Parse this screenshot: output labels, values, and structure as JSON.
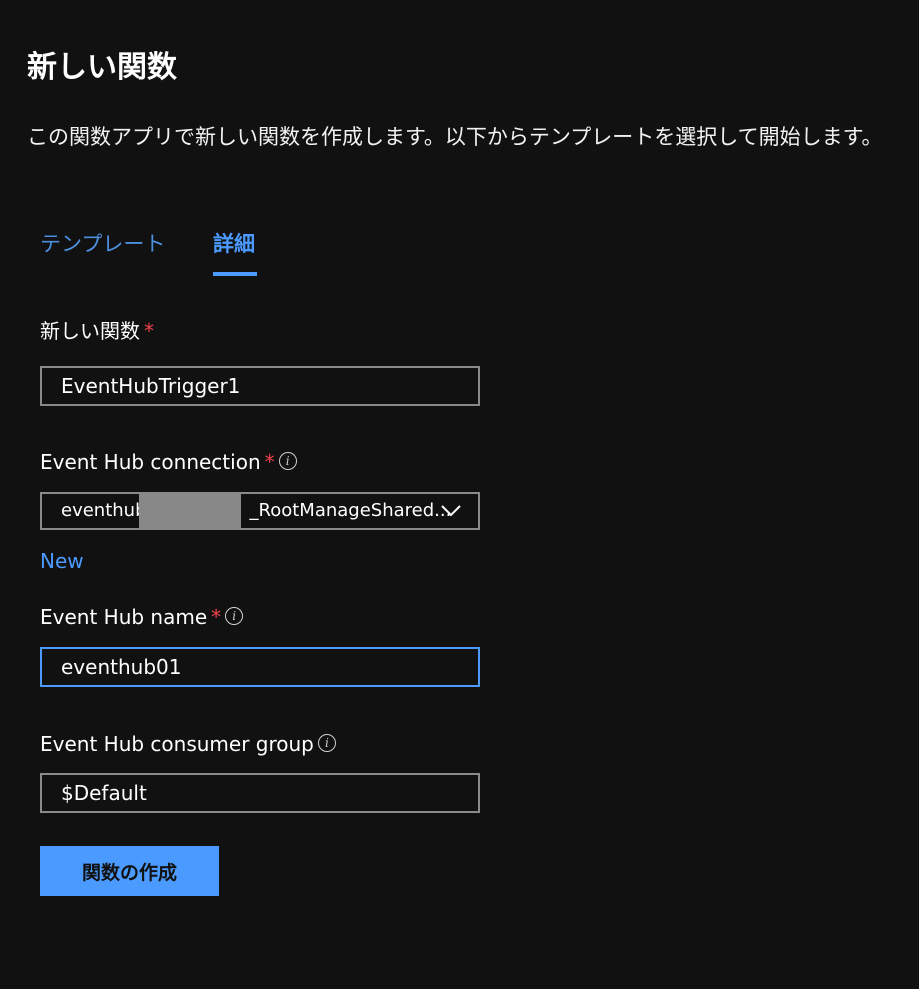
{
  "page": {
    "title": "新しい関数",
    "description": "この関数アプリで新しい関数を作成します。以下からテンプレートを選択して開始します。"
  },
  "tabs": [
    {
      "label": "テンプレート",
      "selected": false
    },
    {
      "label": "詳細",
      "selected": true
    }
  ],
  "form": {
    "function_name": {
      "label": "新しい関数",
      "required": "*",
      "value": "EventHubTrigger1"
    },
    "connection": {
      "label": "Event Hub connection",
      "required": "*",
      "info_icon": "info-icon",
      "value_prefix": "eventhub",
      "value_suffix": "_RootManageShared...",
      "dropdown_icon": "chevron-down-icon",
      "new_link": "New"
    },
    "hub_name": {
      "label": "Event Hub name",
      "required": "*",
      "info_icon": "info-icon",
      "value": "eventhub01"
    },
    "consumer_group": {
      "label": "Event Hub consumer group",
      "info_icon": "info-icon",
      "value": "$Default"
    }
  },
  "actions": {
    "create_label": "関数の作成"
  },
  "colors": {
    "background": "#111111",
    "accent": "#4a9aff",
    "required": "#f0424c",
    "border": "#8a8a8a"
  }
}
